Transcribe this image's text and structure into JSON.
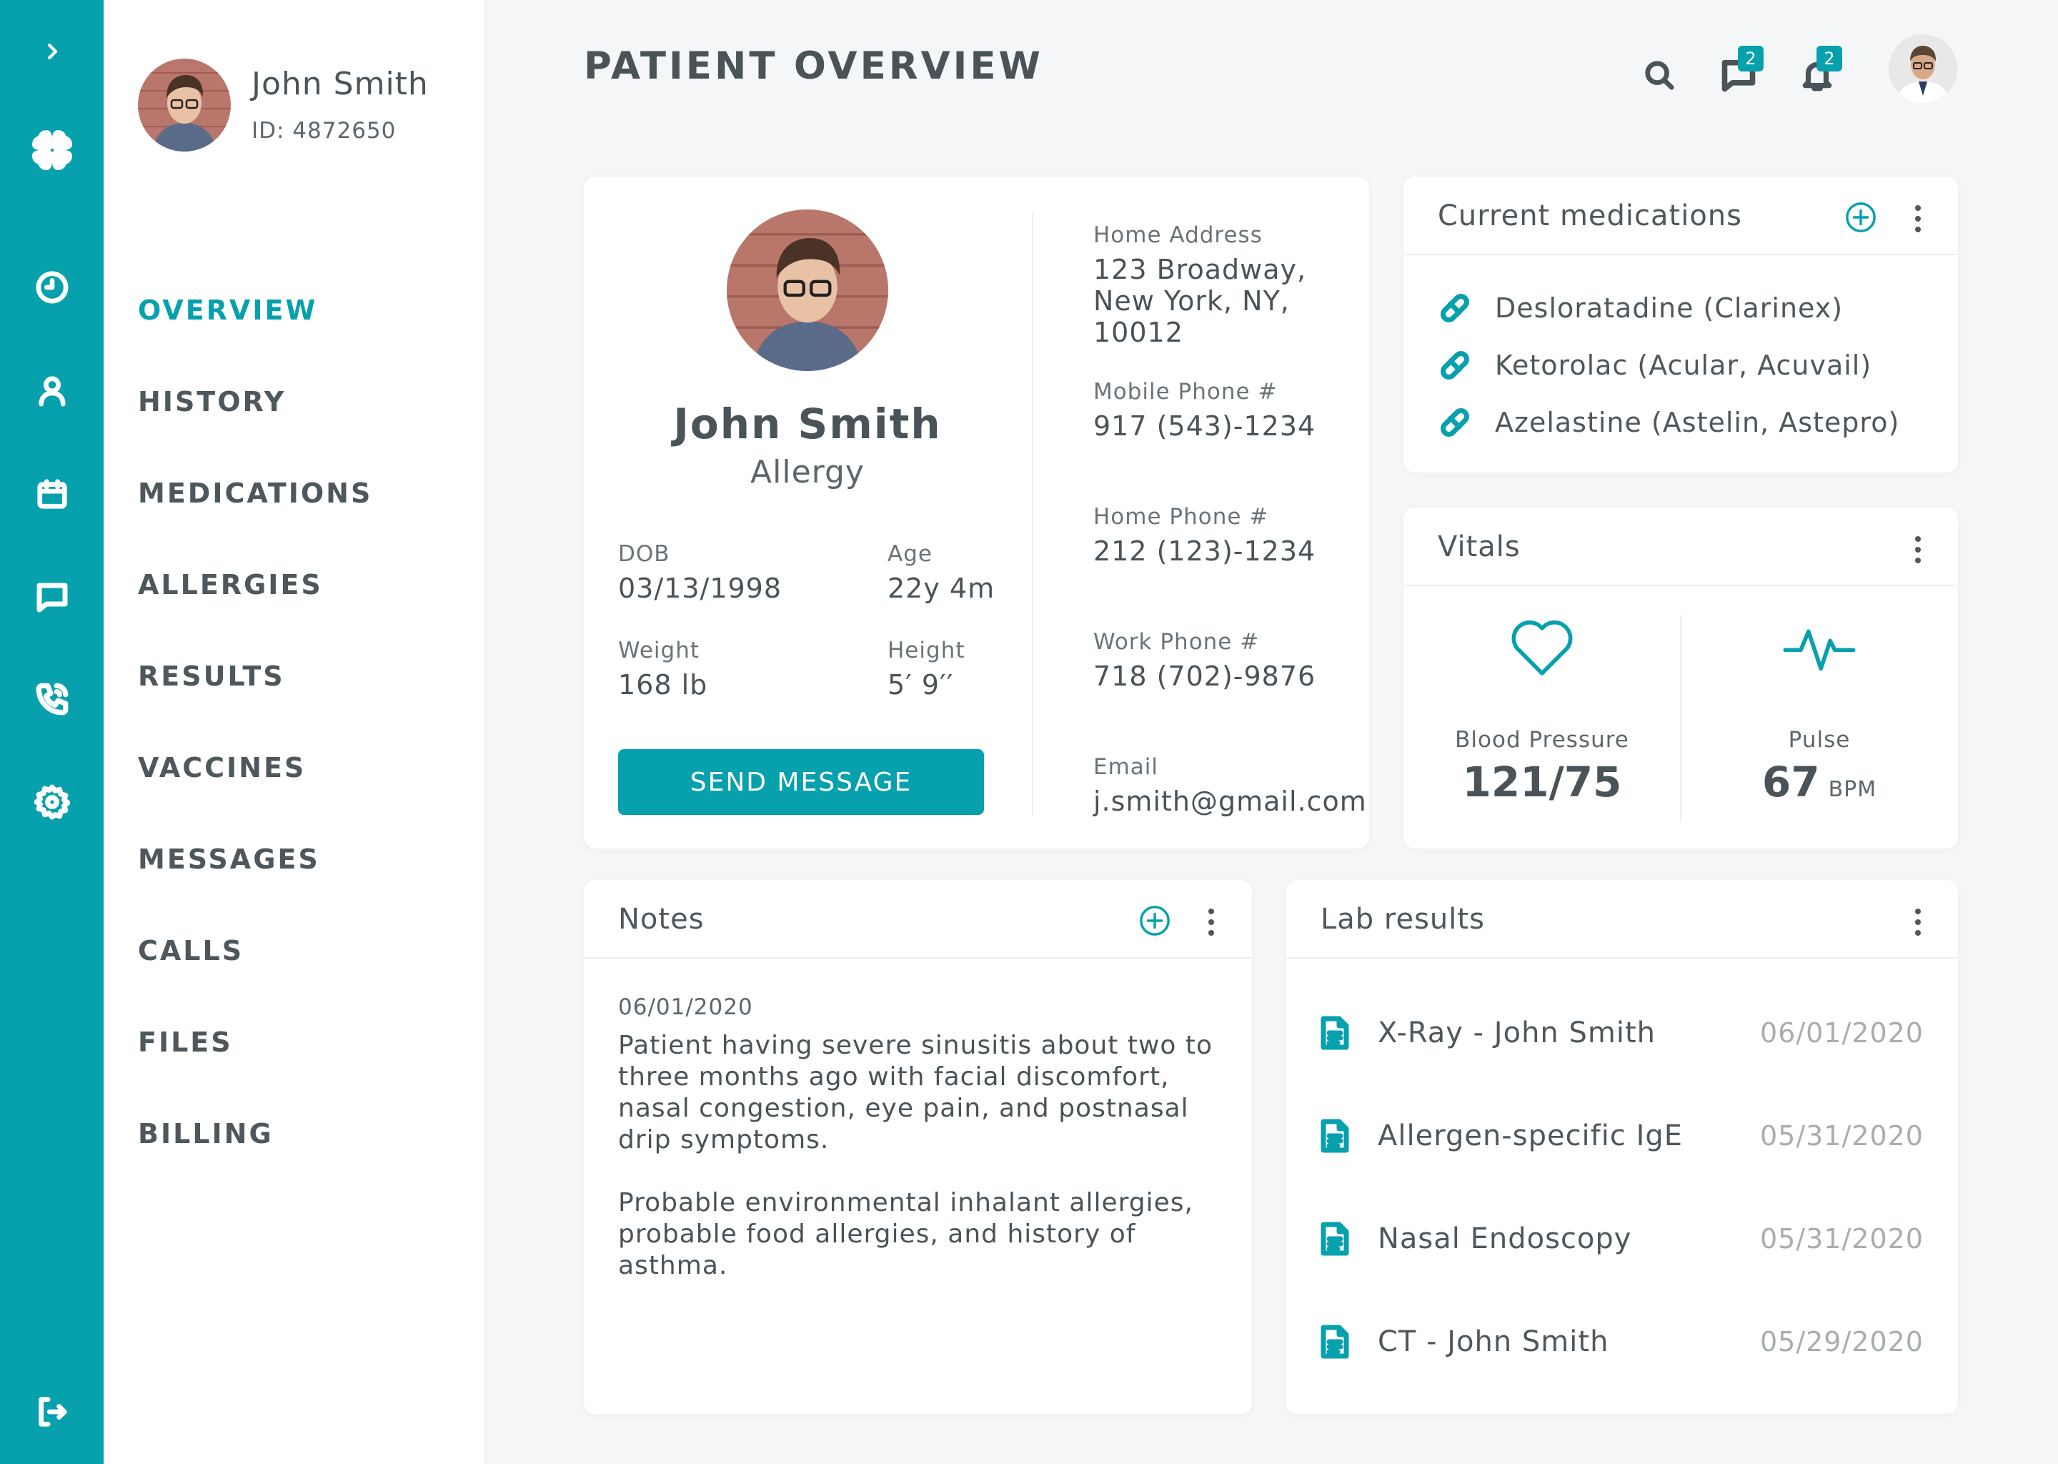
{
  "sidebar": {
    "user_name": "John Smith",
    "user_id": "ID: 4872650",
    "nav": [
      "OVERVIEW",
      "HISTORY",
      "MEDICATIONS",
      "ALLERGIES",
      "RESULTS",
      "VACCINES",
      "MESSAGES",
      "CALLS",
      "FILES",
      "BILLING"
    ],
    "active": "OVERVIEW"
  },
  "rail": {
    "icons": [
      "chevron-right-icon",
      "logo-icon",
      "clock-icon",
      "user-icon",
      "calendar-icon",
      "chat-icon",
      "phone-icon",
      "gear-icon",
      "logout-icon"
    ]
  },
  "header": {
    "title": "PATIENT OVERVIEW",
    "messages_badge": "2",
    "notifications_badge": "2"
  },
  "profile": {
    "name": "John Smith",
    "condition": "Allergy",
    "dob_label": "DOB",
    "dob": "03/13/1998",
    "age_label": "Age",
    "age": "22y 4m",
    "weight_label": "Weight",
    "weight": "168 lb",
    "height_label": "Height",
    "height": "5′ 9′′",
    "send_button": "SEND MESSAGE",
    "home_address_label": "Home Address",
    "home_address_line1": "123 Broadway,",
    "home_address_line2": "New York, NY, 10012",
    "mobile_label": "Mobile Phone #",
    "mobile": "917 (543)-1234",
    "home_phone_label": "Home Phone #",
    "home_phone": "212 (123)-1234",
    "work_phone_label": "Work Phone #",
    "work_phone": "718 (702)-9876",
    "email_label": "Email",
    "email": "j.smith@gmail.com"
  },
  "medications": {
    "title": "Current medications",
    "items": [
      "Desloratadine (Clarinex)",
      "Ketorolac (Acular, Acuvail)",
      "Azelastine (Astelin, Astepro)"
    ]
  },
  "vitals": {
    "title": "Vitals",
    "bp_label": "Blood Pressure",
    "bp_value": "121/75",
    "pulse_label": "Pulse",
    "pulse_value": "67",
    "pulse_unit": "BPM"
  },
  "notes": {
    "title": "Notes",
    "date": "06/01/2020",
    "paragraph1": "Patient having severe sinusitis about two to three months ago with facial discomfort, nasal congestion, eye pain, and postnasal drip symptoms.",
    "paragraph2": "Probable environmental inhalant allergies, probable food allergies, and history of asthma."
  },
  "labs": {
    "title": "Lab results",
    "items": [
      {
        "name": "X-Ray - John Smith",
        "date": "06/01/2020"
      },
      {
        "name": "Allergen-specific IgE",
        "date": "05/31/2020"
      },
      {
        "name": "Nasal Endoscopy",
        "date": "05/31/2020"
      },
      {
        "name": "CT - John Smith",
        "date": "05/29/2020"
      }
    ]
  },
  "colors": {
    "accent": "#07a0ad",
    "text": "#4a5358",
    "muted_date": "#a7adb0",
    "background": "#f5f6f8"
  }
}
